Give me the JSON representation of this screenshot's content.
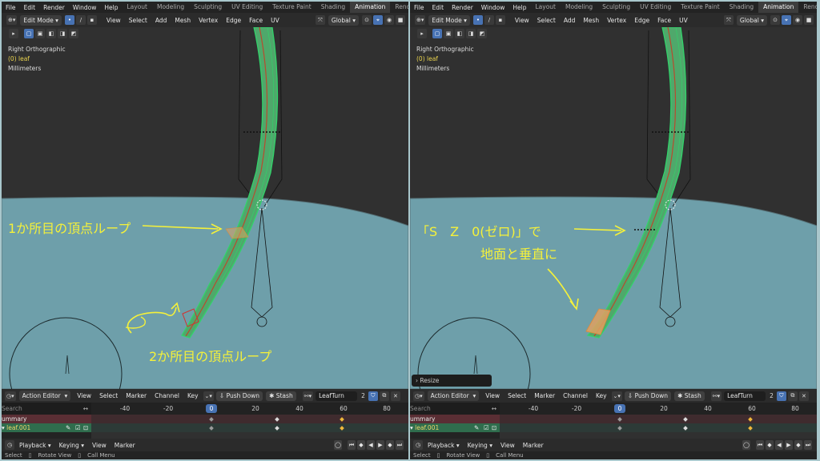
{
  "topbar": {
    "menus": [
      "File",
      "Edit",
      "Render",
      "Window",
      "Help"
    ],
    "workspaces": [
      "Layout",
      "Modeling",
      "Sculpting",
      "UV Editing",
      "Texture Paint",
      "Shading",
      "Animation",
      "Rendering"
    ],
    "active_workspace": "Animation"
  },
  "viewport_header": {
    "mode": "Edit Mode",
    "menus": [
      "View",
      "Select",
      "Add",
      "Mesh",
      "Vertex",
      "Edge",
      "Face",
      "UV"
    ],
    "transform_orientation": "Global"
  },
  "overlay": {
    "view": "Right Orthographic",
    "object": "(0) leaf",
    "units": "Millimeters"
  },
  "annotations": {
    "left_first": "1か所目の頂点ループ",
    "left_second": "2か所目の頂点ループ",
    "right_line1": "「S　Z　0(ゼロ)」で",
    "right_line2": "地面と垂直に"
  },
  "operator_panel": {
    "label": "Resize"
  },
  "action_editor": {
    "mode": "Action Editor",
    "menus": [
      "View",
      "Select",
      "Marker",
      "Channel",
      "Key"
    ],
    "push_down": "Push Down",
    "stash": "Stash",
    "action_name": "LeafTurn",
    "users": "2"
  },
  "timeline": {
    "search_placeholder": "Search",
    "ticks": [
      "-40",
      "-20",
      "0",
      "20",
      "40",
      "60",
      "80"
    ],
    "current_frame": "0",
    "summary_label": "ummary",
    "channel_label": "leaf.001",
    "keyframes": [
      0,
      30,
      60
    ]
  },
  "playback_header": {
    "menus": [
      "Playback",
      "Keying",
      "View",
      "Marker"
    ]
  },
  "statusbar": {
    "items": [
      "Select",
      "Rotate View",
      "Call Menu"
    ]
  },
  "colors": {
    "ground": "#6e9faa",
    "sky": "#303030",
    "mesh_face": "#4fa86b",
    "mesh_edge": "#2fd66a",
    "selected": "#e08a3a",
    "annotation": "#f5f13a",
    "accent": "#4772b3"
  }
}
